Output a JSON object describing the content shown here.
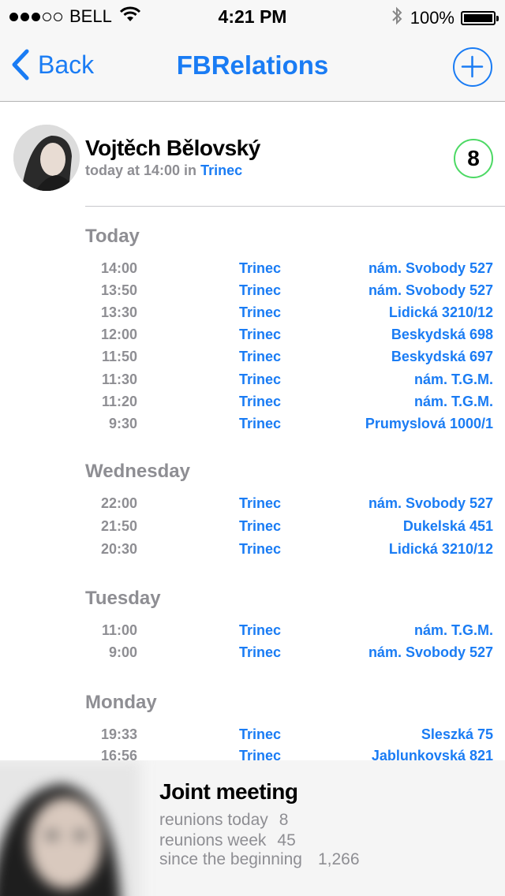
{
  "status_bar": {
    "carrier": "BELL",
    "time": "4:21 PM",
    "battery": "100%"
  },
  "nav": {
    "back_label": "Back",
    "title": "FBRelations",
    "accent_color": "#1a7cf4"
  },
  "profile": {
    "name": "Vojtěch Bělovský",
    "subtitle_prefix": "today at 14:00 in",
    "location": "Trinec",
    "count": "8"
  },
  "log": [
    {
      "day": "Today",
      "entries": [
        {
          "time": "14:00",
          "city": "Trinec",
          "street": "nám. Svobody 527"
        },
        {
          "time": "13:50",
          "city": "Trinec",
          "street": "nám. Svobody 527"
        },
        {
          "time": "13:30",
          "city": "Trinec",
          "street": "Lidická 3210/12"
        },
        {
          "time": "12:00",
          "city": "Trinec",
          "street": "Beskydská 698"
        },
        {
          "time": "11:50",
          "city": "Trinec",
          "street": "Beskydská 697"
        },
        {
          "time": "11:30",
          "city": "Trinec",
          "street": "nám. T.G.M."
        },
        {
          "time": "11:20",
          "city": "Trinec",
          "street": "nám. T.G.M."
        },
        {
          "time": "9:30",
          "city": "Trinec",
          "street": "Prumyslová 1000/1"
        }
      ]
    },
    {
      "day": "Wednesday",
      "entries": [
        {
          "time": "22:00",
          "city": "Trinec",
          "street": "nám. Svobody 527"
        },
        {
          "time": "21:50",
          "city": "Trinec",
          "street": "Dukelská 451"
        },
        {
          "time": "20:30",
          "city": "Trinec",
          "street": "Lidická 3210/12"
        }
      ]
    },
    {
      "day": "Tuesday",
      "entries": [
        {
          "time": "11:00",
          "city": "Trinec",
          "street": "nám. T.G.M."
        },
        {
          "time": "9:00",
          "city": "Trinec",
          "street": "nám. Svobody 527"
        }
      ]
    },
    {
      "day": "Monday",
      "entries": [
        {
          "time": "19:33",
          "city": "Trinec",
          "street": "Sleszká 75"
        },
        {
          "time": "16:56",
          "city": "Trinec",
          "street": "Jablunkovská 821"
        }
      ]
    }
  ],
  "joint": {
    "title": "Joint meeting",
    "stats": [
      {
        "label": "reunions today",
        "value": "8"
      },
      {
        "label": "reunions week",
        "value": "45"
      },
      {
        "label": "since the beginning",
        "value": "1,266"
      }
    ]
  }
}
